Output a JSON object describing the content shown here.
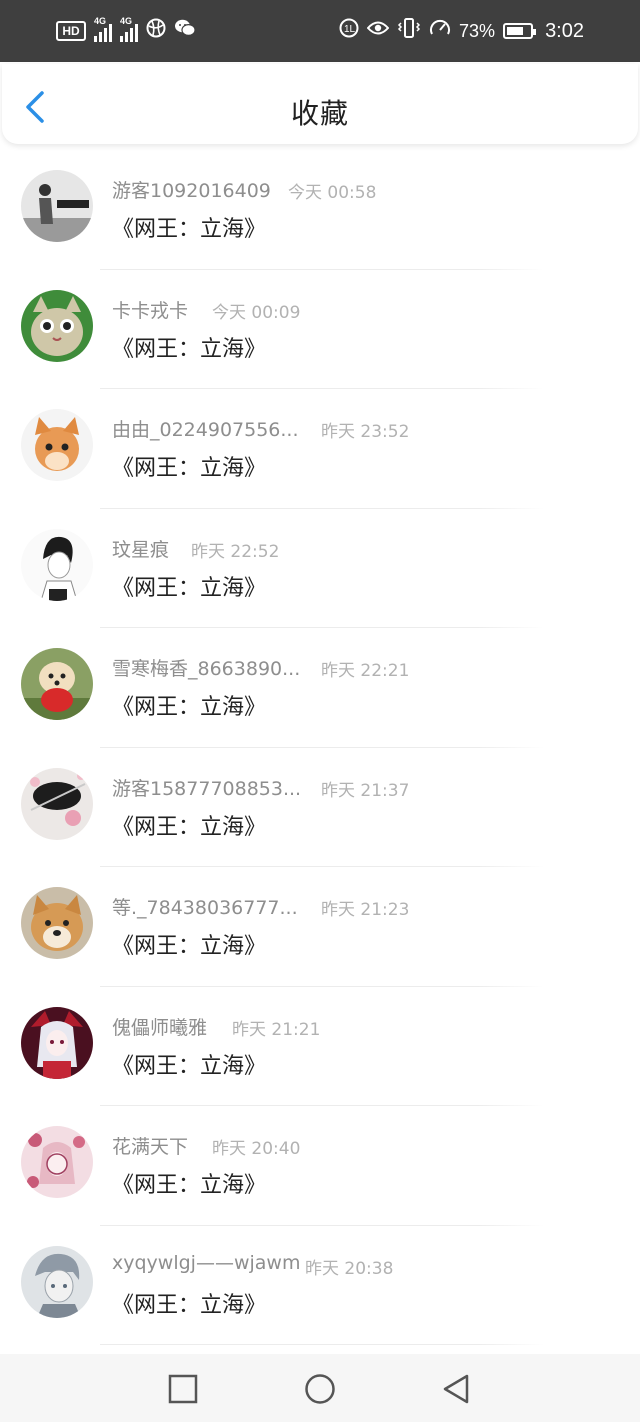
{
  "status_bar": {
    "hd_label": "HD",
    "net1": "4G",
    "net2": "4G",
    "battery_percent": "73%",
    "battery_level": 0.73,
    "time": "3:02",
    "icons": [
      "hd-icon",
      "signal-icon",
      "signal-icon",
      "globe-icon",
      "wechat-icon",
      "nfc-icon",
      "eye-icon",
      "vibrate-icon",
      "speed-icon",
      "battery-icon"
    ]
  },
  "header": {
    "title": "收藏",
    "back_icon": "chevron-left-icon"
  },
  "accent_color": "#2b8fe6",
  "favorites": [
    {
      "user": "游客1092016409",
      "time": "今天 00:58",
      "title": "《网王：立海》"
    },
    {
      "user": "卡卡戎卡",
      "time": "今天 00:09",
      "title": "《网王：立海》"
    },
    {
      "user": "由由_0224907556...",
      "time": "昨天 23:52",
      "title": "《网王：立海》"
    },
    {
      "user": "玟星痕",
      "time": "昨天 22:52",
      "title": "《网王：立海》"
    },
    {
      "user": "雪寒梅香_8663890...",
      "time": "昨天 22:21",
      "title": "《网王：立海》"
    },
    {
      "user": "游客15877708853...",
      "time": "昨天 21:37",
      "title": "《网王：立海》"
    },
    {
      "user": "等._78438036777...",
      "time": "昨天 21:23",
      "title": "《网王：立海》"
    },
    {
      "user": "傀儡师曦雅",
      "time": "昨天 21:21",
      "title": "《网王：立海》"
    },
    {
      "user": "花满天下",
      "time": "昨天 20:40",
      "title": "《网王：立海》"
    },
    {
      "user": "xyqywlgj——wjawm",
      "time": "昨天 20:38",
      "title": "《网王：立海》"
    }
  ],
  "nav": {
    "icons": [
      "recent-apps-icon",
      "home-icon",
      "back-icon"
    ]
  }
}
